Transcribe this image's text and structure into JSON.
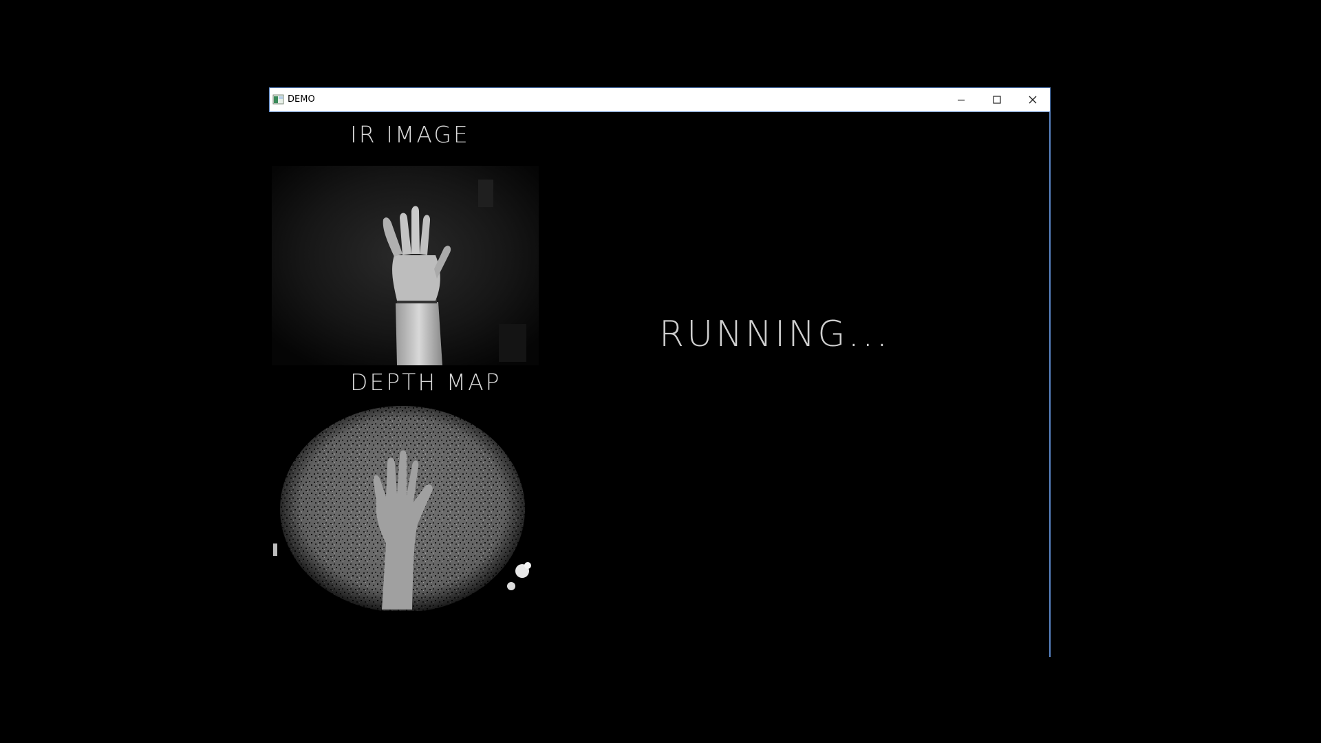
{
  "window": {
    "title": "DEMO",
    "icon": "app-window-icon",
    "controls": [
      "minimize-icon",
      "maximize-icon",
      "close-icon"
    ]
  },
  "panels": {
    "ir_label": "IR IMAGE",
    "depth_label": "DEPTH MAP"
  },
  "status": {
    "text": "RUNNING..."
  },
  "colors": {
    "background": "#000000",
    "titlebar": "#ffffff",
    "border_accent": "#5b87c7",
    "label_text": "#d8d8d8"
  }
}
